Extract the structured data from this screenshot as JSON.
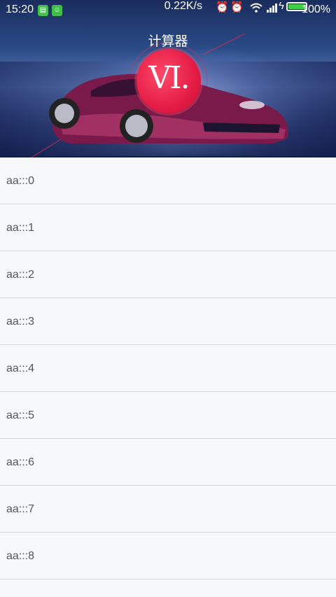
{
  "status_bar": {
    "time": "15:20",
    "net_speed": "0.22K/s",
    "battery_pct": "100%",
    "icons": [
      "sim-notification-icon",
      "android-notification-icon",
      "alarm-off-icon",
      "alarm-icon",
      "wifi-icon",
      "signal-icon",
      "charging-icon",
      "battery-icon"
    ]
  },
  "header": {
    "title": "计算器",
    "logo_text": "VI."
  },
  "list": {
    "items": [
      "aa:::0",
      "aa:::1",
      "aa:::2",
      "aa:::3",
      "aa:::4",
      "aa:::5",
      "aa:::6",
      "aa:::7",
      "aa:::8"
    ]
  },
  "colors": {
    "logo_red": "#e41c45",
    "list_bg": "#f7f8fa",
    "divider": "#d4d6da",
    "battery_green": "#3fd04a"
  }
}
